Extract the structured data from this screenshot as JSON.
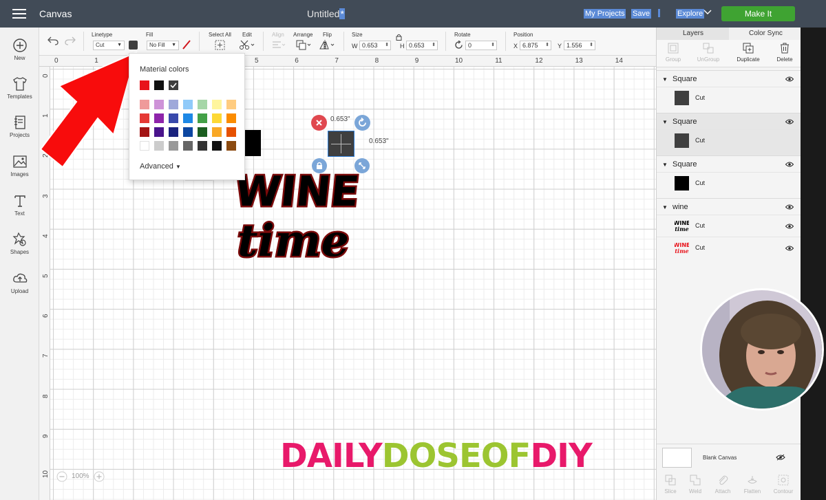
{
  "topbar": {
    "app_name": "Canvas",
    "doc_title": "Untitled",
    "doc_title_mark": "*",
    "my_projects": "My Projects",
    "save": "Save",
    "explore": "Explore",
    "make_it": "Make It"
  },
  "leftbar": {
    "items": [
      {
        "label": "New",
        "icon": "plus-circle-icon"
      },
      {
        "label": "Templates",
        "icon": "shirt-icon"
      },
      {
        "label": "Projects",
        "icon": "notebook-icon"
      },
      {
        "label": "Images",
        "icon": "image-icon"
      },
      {
        "label": "Text",
        "icon": "text-icon"
      },
      {
        "label": "Shapes",
        "icon": "shapes-icon"
      },
      {
        "label": "Upload",
        "icon": "upload-icon"
      }
    ]
  },
  "toolbar": {
    "linetype_label": "Linetype",
    "linetype_value": "Cut",
    "fill_label": "Fill",
    "fill_value": "No Fill",
    "select_all_label": "Select All",
    "edit_label": "Edit",
    "align_label": "Align",
    "arrange_label": "Arrange",
    "flip_label": "Flip",
    "size_label": "Size",
    "w_label": "W",
    "w_value": "0.653",
    "h_label": "H",
    "h_value": "0.653",
    "rotate_label": "Rotate",
    "rotate_value": "0",
    "position_label": "Position",
    "x_label": "X",
    "x_value": "6.875",
    "y_label": "Y",
    "y_value": "1.556",
    "linetype_color": "#3f3f3f"
  },
  "ruler": {
    "top": [
      "0",
      "1",
      "2",
      "3",
      "4",
      "5",
      "6",
      "7",
      "8",
      "9",
      "10",
      "11",
      "12",
      "13",
      "14"
    ],
    "left": [
      "0",
      "1",
      "2",
      "3",
      "4",
      "5",
      "6",
      "7",
      "8",
      "9",
      "10"
    ]
  },
  "popover": {
    "title": "Material colors",
    "advanced": "Advanced",
    "top_row": [
      "#e8131b",
      "#111111",
      "#3f3f3f"
    ],
    "rows": [
      [
        "#ef9a9a",
        "#ce93d8",
        "#9fa8da",
        "#90caf9",
        "#a5d6a7",
        "#fff59d",
        "#ffcc80"
      ],
      [
        "#e53935",
        "#8e24aa",
        "#3949ab",
        "#1e88e5",
        "#43a047",
        "#fdd835",
        "#fb8c00"
      ],
      [
        "#a31515",
        "#4a148c",
        "#1a237e",
        "#0d47a1",
        "#1b5e20",
        "#f9a825",
        "#e65100"
      ],
      [
        "#ffffff",
        "#cccccc",
        "#999999",
        "#666666",
        "#333333",
        "#111111",
        "#8b4a10"
      ]
    ]
  },
  "selection": {
    "width_label": "0.653\"",
    "height_label": "0.653\""
  },
  "artwork": {
    "line1": "WINE",
    "line2": "time"
  },
  "watermark": {
    "part1": "DAILY",
    "part2": "DOSEOF",
    "part3": "DIY",
    "color1": "#e8196a",
    "color2": "#9cc531",
    "color3": "#e8196a"
  },
  "zoom": {
    "value": "100%"
  },
  "rightpanel": {
    "tab_layers": "Layers",
    "tab_color_sync": "Color Sync",
    "tools": [
      {
        "label": "Group",
        "enabled": false
      },
      {
        "label": "UnGroup",
        "enabled": false
      },
      {
        "label": "Duplicate",
        "enabled": true
      },
      {
        "label": "Delete",
        "enabled": true
      }
    ],
    "layers": [
      {
        "name": "Square",
        "op": "Cut",
        "thumb": "#3f3f3f"
      },
      {
        "name": "Square",
        "op": "Cut",
        "thumb": "#3f3f3f"
      },
      {
        "name": "Square",
        "op": "Cut",
        "thumb": "#000000"
      }
    ],
    "wine_group": {
      "name": "wine",
      "rows": [
        {
          "op": "Cut",
          "thumb_text": "WINE time",
          "thumb_color": "#000000"
        },
        {
          "op": "Cut",
          "thumb_text": "WINE time",
          "thumb_color": "#e8131b"
        }
      ]
    },
    "blank_canvas": "Blank Canvas",
    "actions": [
      "Slice",
      "Weld",
      "Attach",
      "Flatten",
      "Contour"
    ]
  }
}
